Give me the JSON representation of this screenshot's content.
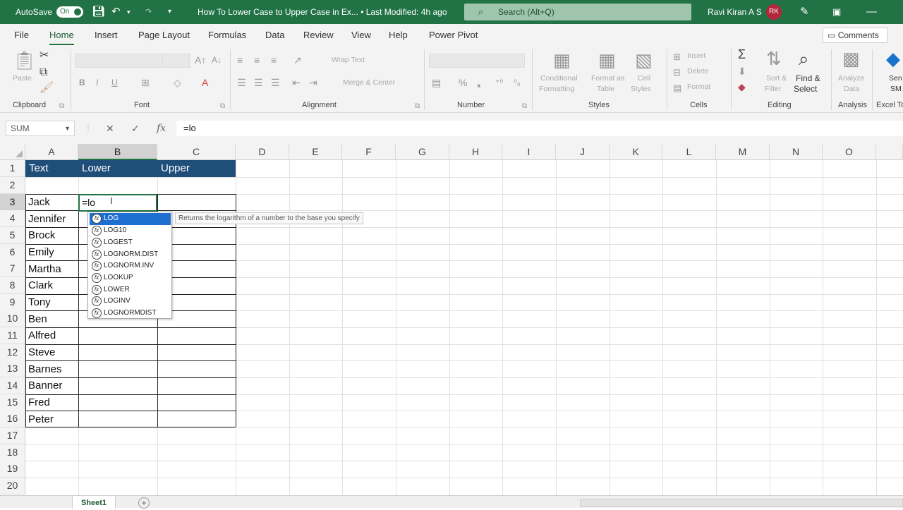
{
  "title_bar": {
    "autosave_label": "AutoSave",
    "autosave_state": "On",
    "document_title": "How To Lower Case to Upper Case in Ex... • Last Modified: 4h ago",
    "search_placeholder": "Search (Alt+Q)",
    "user_name": "Ravi Kiran A S",
    "user_initials": "RK"
  },
  "menu": {
    "tabs": [
      "File",
      "Home",
      "Insert",
      "Page Layout",
      "Formulas",
      "Data",
      "Review",
      "View",
      "Help",
      "Power Pivot"
    ],
    "active_tab": "Home",
    "comments_label": "Comments"
  },
  "ribbon": {
    "groups": [
      "Clipboard",
      "Font",
      "Alignment",
      "Number",
      "Styles",
      "Cells",
      "Editing",
      "Analysis",
      "Excel To"
    ],
    "paste_label": "Paste",
    "wrap_text": "Wrap Text",
    "merge_center": "Merge & Center",
    "conditional_formatting": [
      "Conditional",
      "Formatting"
    ],
    "format_as_table": [
      "Format as",
      "Table"
    ],
    "cell_styles": [
      "Cell",
      "Styles"
    ],
    "insert": "Insert",
    "delete": "Delete",
    "format": "Format",
    "sort_filter": [
      "Sort &",
      "Filter"
    ],
    "find_select": [
      "Find &",
      "Select"
    ],
    "analyze_data": [
      "Analyze",
      "Data"
    ],
    "send": [
      "Sen",
      "SM"
    ]
  },
  "formula_bar": {
    "name_box": "SUM",
    "formula": "=lo"
  },
  "grid": {
    "columns": [
      "A",
      "B",
      "C",
      "D",
      "E",
      "F",
      "G",
      "H",
      "I",
      "J",
      "K",
      "L",
      "M",
      "N",
      "O"
    ],
    "rows": [
      "1",
      "2",
      "3",
      "4",
      "5",
      "6",
      "7",
      "8",
      "9",
      "10",
      "11",
      "12",
      "13",
      "14",
      "15",
      "16",
      "17",
      "18",
      "19",
      "20"
    ],
    "selected_column": "B",
    "selected_row": "3"
  },
  "table": {
    "headers": [
      "Text",
      "Lower",
      "Upper"
    ],
    "names": [
      "Jack",
      "Jennifer",
      "Brock",
      "Emily",
      "Martha",
      "Clark",
      "Tony",
      "Ben",
      "Alfred",
      "Steve",
      "Barnes",
      "Banner",
      "Fred",
      "Peter"
    ],
    "active_cell_value": "=lo"
  },
  "autocomplete": {
    "items": [
      "LOG",
      "LOG10",
      "LOGEST",
      "LOGNORM.DIST",
      "LOGNORM.INV",
      "LOOKUP",
      "LOWER",
      "LOGINV",
      "LOGNORMDIST"
    ],
    "selected_index": 0,
    "tooltip": "Returns the logarithm of a number to the base you specify"
  },
  "sheets": {
    "active": "Sheet1"
  },
  "colors": {
    "accent": "#217346",
    "header_fill": "#1f4e79",
    "autocomplete_selection": "#1f6fd1"
  }
}
